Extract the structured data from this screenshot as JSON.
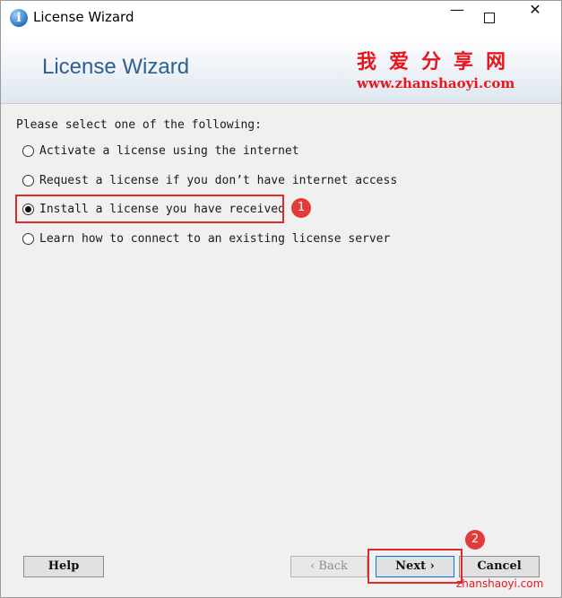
{
  "window": {
    "title": "License Wizard",
    "minimize": "—",
    "maximize": "☐",
    "close": "✕"
  },
  "banner": {
    "title": "License Wizard",
    "watermark_cn": "我爱分享网",
    "watermark_url": "www.zhanshaoyi.com"
  },
  "main": {
    "prompt": "Please select one of the following:",
    "options": [
      {
        "label": "Activate a license using the internet",
        "selected": false
      },
      {
        "label": "Request a license if you don’t have internet access",
        "selected": false
      },
      {
        "label": "Install a license you have received",
        "selected": true
      },
      {
        "label": "Learn how to connect to an existing license server",
        "selected": false
      }
    ]
  },
  "annotations": {
    "step1": "1",
    "step2": "2",
    "color": "#e23b3b"
  },
  "buttons": {
    "help": "Help",
    "back": "‹ Back",
    "next": "Next ›",
    "cancel": "Cancel"
  },
  "footer": {
    "watermark": "zhanshaoyi.com"
  }
}
